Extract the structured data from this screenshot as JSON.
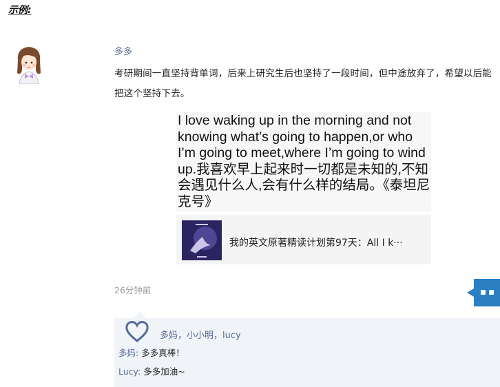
{
  "header": {
    "example_label": "示例:"
  },
  "post": {
    "author": "多多",
    "text": "考研期间一直坚持背单词，后来上研究生后也坚持了一段时间，但中途放弃了，希望以后能把这个坚持下去。",
    "quote": "I love waking up in the morning and not knowing what’s going to happen,or who I’m going to meet,where I’m going to wind up.我喜欢早上起来时一切都是未知的,不知会遇见什么人,会有什么样的结局。《泰坦尼克号》",
    "link_title": "我的英文原著精读计划第97天：All I k···",
    "time": "26分钟前"
  },
  "interactions": {
    "likers": "多妈，小小明，lucy",
    "comments": [
      {
        "name": "多妈",
        "sep": ": ",
        "text": "多多真棒！"
      },
      {
        "name": "Lucy",
        "sep": ": ",
        "text": "多多加油~"
      }
    ]
  },
  "icons": {
    "like": "heart-outline-icon",
    "more": "more-dots-icon",
    "avatar": "girl-avatar"
  },
  "colors": {
    "link_blue": "#576b95",
    "interaction_bg": "#f0f3f8",
    "more_button": "#2b7fc3"
  }
}
